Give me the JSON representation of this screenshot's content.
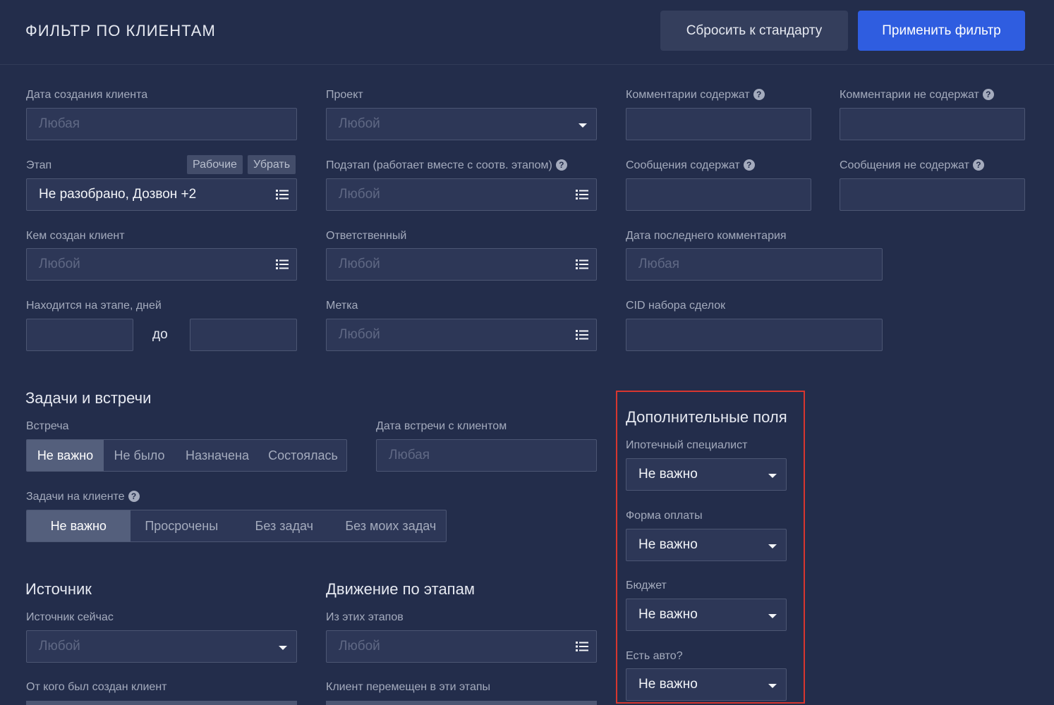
{
  "header": {
    "title": "ФИЛЬТР ПО КЛИЕНТАМ",
    "reset_label": "Сбросить к стандарту",
    "apply_label": "Применить фильтр"
  },
  "filters": {
    "created_date": {
      "label": "Дата создания клиента",
      "placeholder": "Любая"
    },
    "project": {
      "label": "Проект",
      "placeholder": "Любой"
    },
    "comments_contain": {
      "label": "Комментарии содержат",
      "value": ""
    },
    "comments_not_contain": {
      "label": "Комментарии не содержат",
      "value": ""
    },
    "stage": {
      "label": "Этап",
      "value": "Не разобрано, Дозвон +2",
      "chip_work": "Рабочие",
      "chip_remove": "Убрать"
    },
    "substage": {
      "label": "Подэтап (работает вместе с соотв. этапом)",
      "placeholder": "Любой"
    },
    "messages_contain": {
      "label": "Сообщения содержат",
      "value": ""
    },
    "messages_not_contain": {
      "label": "Сообщения не содержат",
      "value": ""
    },
    "created_by": {
      "label": "Кем создан клиент",
      "placeholder": "Любой"
    },
    "responsible": {
      "label": "Ответственный",
      "placeholder": "Любой"
    },
    "last_comment_date": {
      "label": "Дата последнего комментария",
      "placeholder": "Любая"
    },
    "days_on_stage": {
      "label": "Находится на этапе, дней",
      "to": "до"
    },
    "tag": {
      "label": "Метка",
      "placeholder": "Любой"
    },
    "cid": {
      "label": "CID набора сделок",
      "value": ""
    }
  },
  "tasks": {
    "heading": "Задачи и встречи",
    "meeting_label": "Встреча",
    "meeting_options": [
      "Не важно",
      "Не было",
      "Назначена",
      "Состоялась"
    ],
    "meeting_date_label": "Дата встречи с клиентом",
    "meeting_date_placeholder": "Любая",
    "tasks_label": "Задачи на клиенте",
    "tasks_options": [
      "Не важно",
      "Просрочены",
      "Без задач",
      "Без моих задач"
    ]
  },
  "source": {
    "heading": "Источник",
    "current_label": "Источник сейчас",
    "current_placeholder": "Любой",
    "creator_label": "От кого был создан клиент"
  },
  "movement": {
    "heading": "Движение по этапам",
    "from_label": "Из этих этапов",
    "from_placeholder": "Любой",
    "moved_label": "Клиент перемещен в эти этапы"
  },
  "extra": {
    "heading": "Дополнительные поля",
    "fields": [
      {
        "label": "Ипотечный специалист",
        "value": "Не важно"
      },
      {
        "label": "Форма оплаты",
        "value": "Не важно"
      },
      {
        "label": "Бюджет",
        "value": "Не важно"
      },
      {
        "label": "Есть авто?",
        "value": "Не важно"
      }
    ]
  },
  "colors": {
    "background": "#232d4b",
    "accent": "#2f5de0",
    "highlight": "#d7362f"
  }
}
